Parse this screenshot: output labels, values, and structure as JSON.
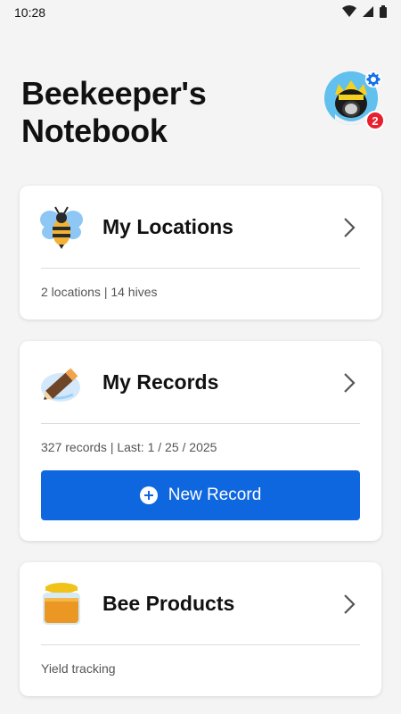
{
  "status_bar": {
    "time": "10:28",
    "icons": [
      "wifi-icon",
      "signal-icon",
      "battery-icon"
    ]
  },
  "header": {
    "title_line1": "Beekeeper's",
    "title_line2": "Notebook"
  },
  "profile": {
    "notification_count": "2",
    "icons": [
      "avatar-icon",
      "gear-icon"
    ]
  },
  "cards": {
    "locations": {
      "title": "My Locations",
      "meta": "2 locations | 14 hives",
      "icon": "bee-icon"
    },
    "records": {
      "title": "My Records",
      "meta": "327 records | Last: 1 / 25 / 2025",
      "button_label": "New Record",
      "icon": "pencil-icon"
    },
    "products": {
      "title": "Bee Products",
      "meta": "Yield tracking",
      "icon": "honey-jar-icon"
    }
  },
  "colors": {
    "primary": "#0f67e0",
    "badge": "#e81f2c",
    "background": "#f4f4f4"
  }
}
